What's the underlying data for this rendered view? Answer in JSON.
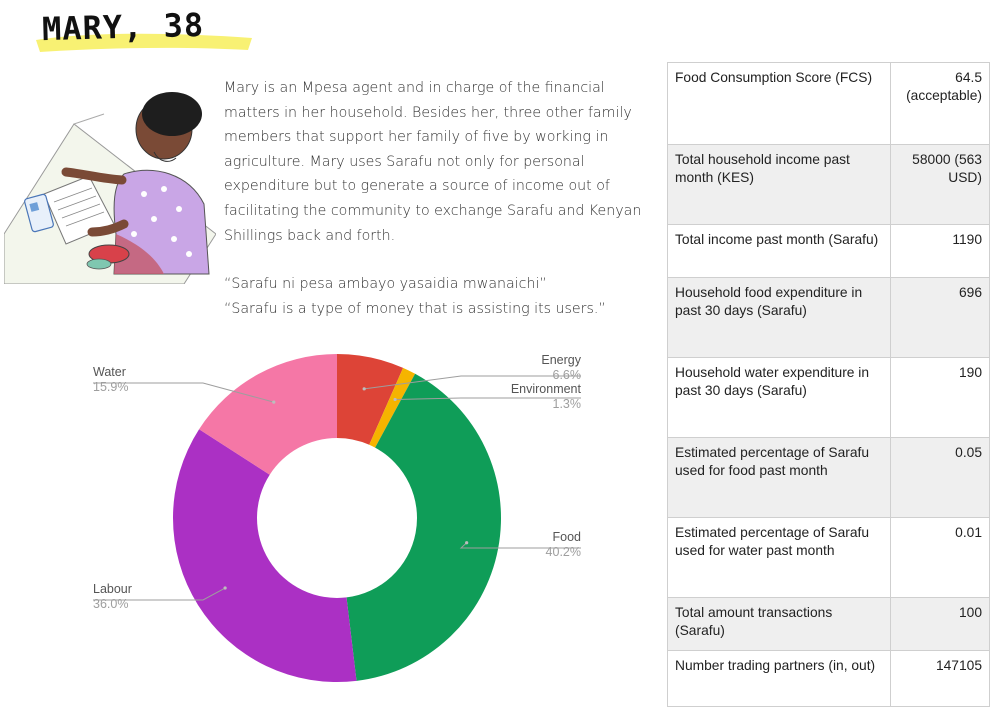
{
  "profile": {
    "title": "MARY, 38",
    "paragraph": "Mary is an Mpesa agent and in charge of the financial matters in her household. Besides her, three other family members that support her family of five by working in agriculture. Mary uses Sarafu not only for personal expenditure but to generate a source of income out of facilitating the community to exchange Sarafu and Kenyan Shillings back and forth.",
    "quote_swahili": "“Sarafu ni pesa ambayo yasaidia mwanaichi”",
    "quote_english": "“Sarafu is a type of money that is assisting its users.”"
  },
  "chart_data": {
    "type": "pie",
    "donut": true,
    "categories": [
      "Energy",
      "Environment",
      "Food",
      "Labour",
      "Water"
    ],
    "values": [
      6.6,
      1.3,
      40.2,
      36.0,
      15.9
    ],
    "value_labels": [
      "6.6%",
      "1.3%",
      "40.2%",
      "36.0%",
      "15.9%"
    ],
    "colors": [
      "#dd4437",
      "#f5b400",
      "#0f9d58",
      "#ab30c4",
      "#f577a6"
    ],
    "legend": "labels-with-leader-lines"
  },
  "stats": {
    "rows": [
      {
        "label": "Food Consumption Score (FCS)",
        "value": "64.5 (acceptable)"
      },
      {
        "label": "Total household income past month (KES)",
        "value": "58000 (563 USD)"
      },
      {
        "label": "Total income past month (Sarafu)",
        "value": "1190"
      },
      {
        "label": "Household food expenditure in past 30 days (Sarafu)",
        "value": "696"
      },
      {
        "label": "Household water expenditure in past 30 days (Sarafu)",
        "value": "190"
      },
      {
        "label": "Estimated percentage of Sarafu used for food past month",
        "value": "0.05"
      },
      {
        "label": "Estimated percentage of Sarafu used for water past month",
        "value": "0.01"
      },
      {
        "label": "Total amount transactions (Sarafu)",
        "value": "100"
      },
      {
        "label": "Number trading partners (in, out)",
        "value": "147105"
      }
    ]
  }
}
